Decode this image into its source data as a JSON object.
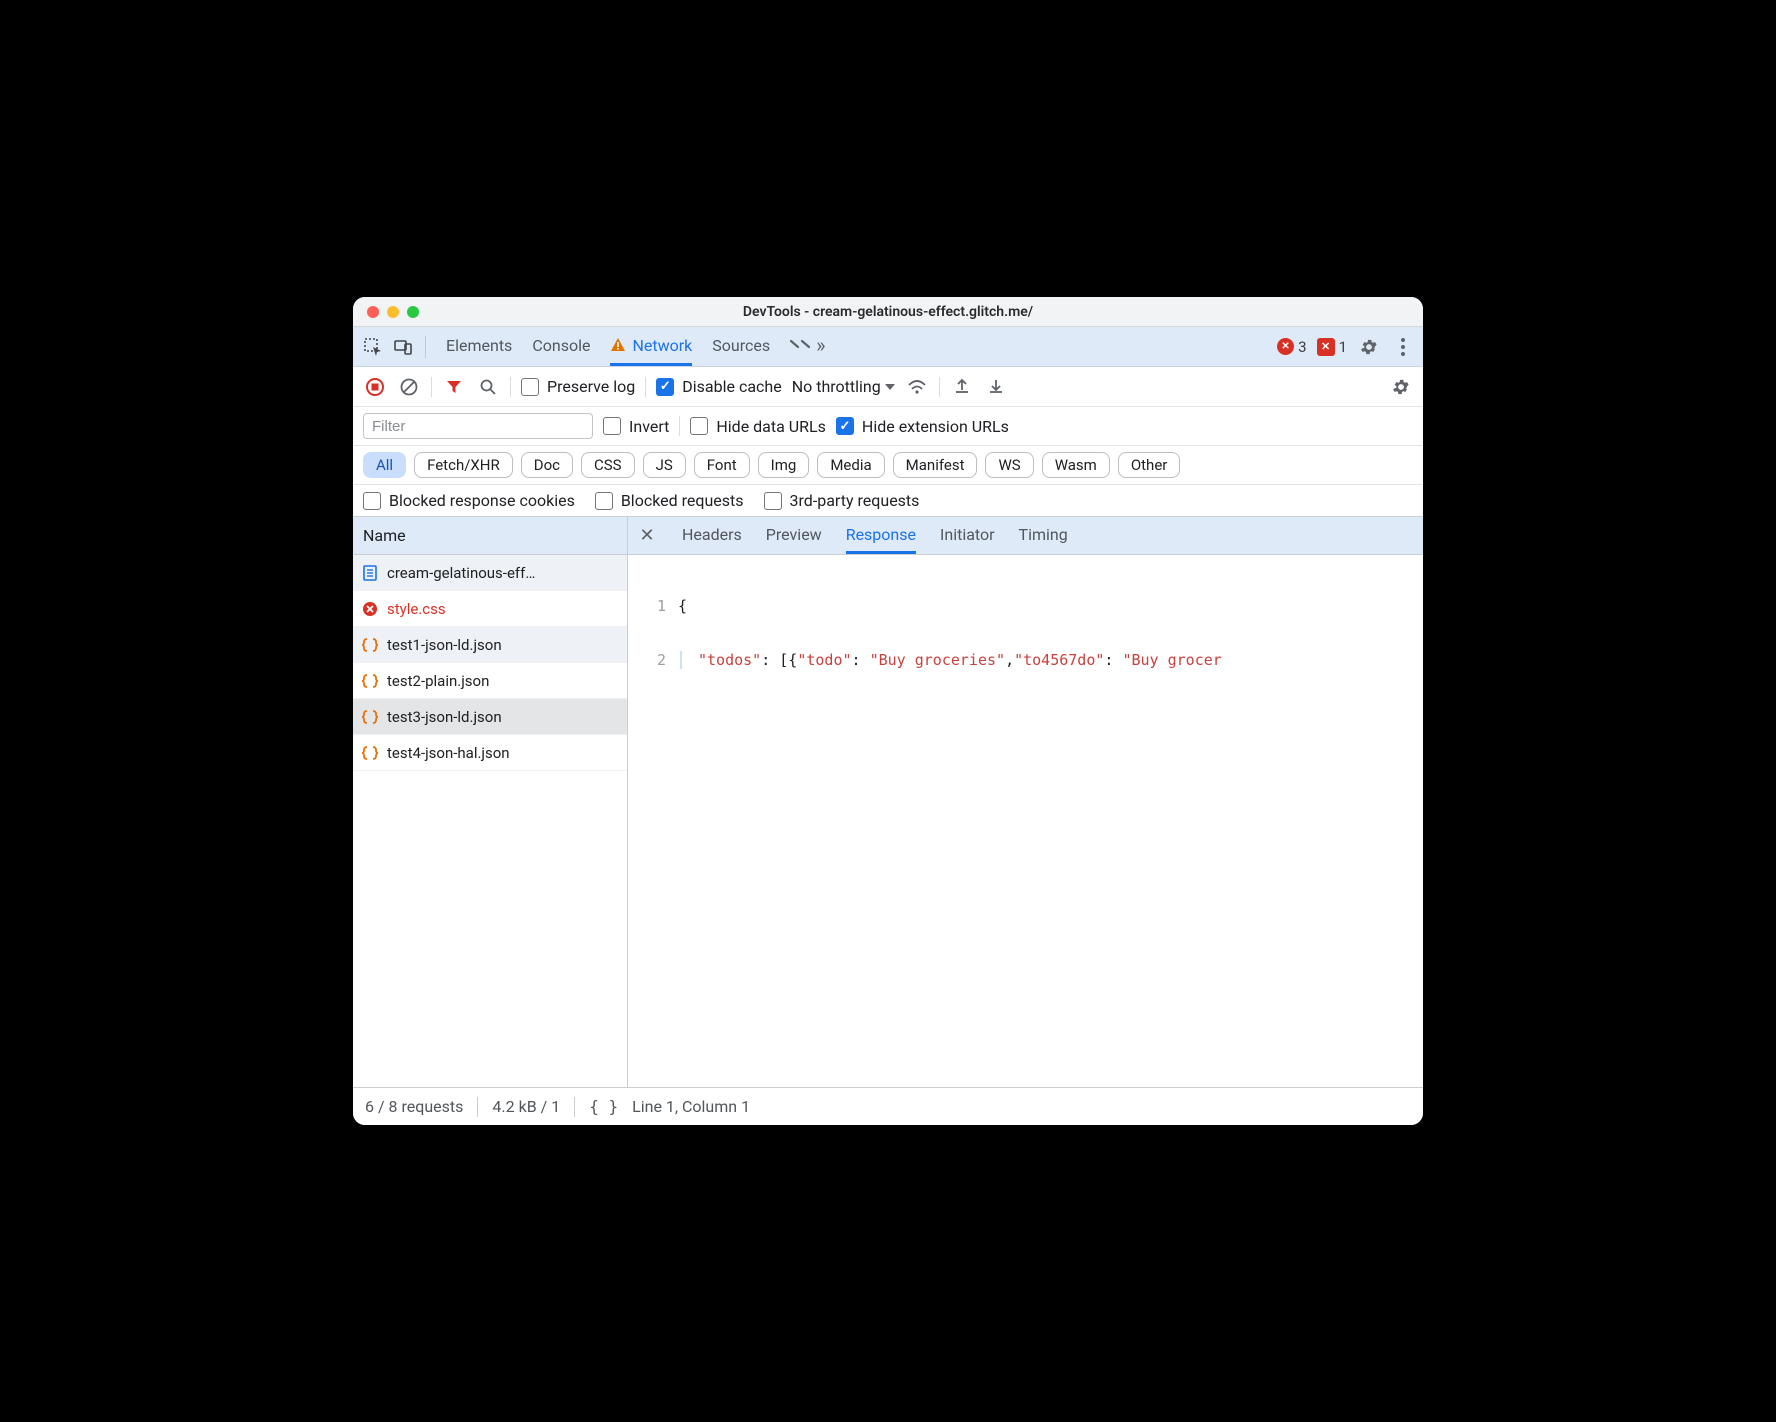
{
  "window": {
    "title": "DevTools - cream-gelatinous-effect.glitch.me/"
  },
  "tabs": {
    "elements": "Elements",
    "console": "Console",
    "network": "Network",
    "sources": "Sources",
    "active": "network",
    "errors_count": "3",
    "issues_count": "1"
  },
  "toolbar": {
    "preserve_log": "Preserve log",
    "disable_cache": "Disable cache",
    "throttling": "No throttling"
  },
  "filters": {
    "filter_placeholder": "Filter",
    "invert": "Invert",
    "hide_data_urls": "Hide data URLs",
    "hide_ext_urls": "Hide extension URLs"
  },
  "chips": [
    "All",
    "Fetch/XHR",
    "Doc",
    "CSS",
    "JS",
    "Font",
    "Img",
    "Media",
    "Manifest",
    "WS",
    "Wasm",
    "Other"
  ],
  "chip_active_index": 0,
  "extra": {
    "blocked_cookies": "Blocked response cookies",
    "blocked_requests": "Blocked requests",
    "third_party": "3rd-party requests"
  },
  "sidebar": {
    "header": "Name"
  },
  "requests": [
    {
      "name": "cream-gelatinous-eff…",
      "icon": "doc",
      "state": "selected"
    },
    {
      "name": "style.css",
      "icon": "error",
      "state": "error"
    },
    {
      "name": "test1-json-ld.json",
      "icon": "json",
      "state": "selected"
    },
    {
      "name": "test2-plain.json",
      "icon": "json",
      "state": ""
    },
    {
      "name": "test3-json-ld.json",
      "icon": "json",
      "state": "hover-sel"
    },
    {
      "name": "test4-json-hal.json",
      "icon": "json",
      "state": ""
    }
  ],
  "detail": {
    "tabs": {
      "headers": "Headers",
      "preview": "Preview",
      "response": "Response",
      "initiator": "Initiator",
      "timing": "Timing"
    },
    "active": "response"
  },
  "response": {
    "line1_gutter": "1",
    "line1": "{",
    "line2_gutter": "2",
    "line2_key1": "\"todos\"",
    "line2_colon": ": ",
    "line2_open": "[{",
    "line2_key2": "\"todo\"",
    "line2_colon2": ": ",
    "line2_val1": "\"Buy groceries\"",
    "line2_comma": ",",
    "line2_key3": "\"to4567do\"",
    "line2_colon3": ": ",
    "line2_val2": "\"Buy grocer"
  },
  "status": {
    "requests": "6 / 8 requests",
    "transfer": "4.2 kB / 1",
    "cursor": "Line 1, Column 1"
  }
}
